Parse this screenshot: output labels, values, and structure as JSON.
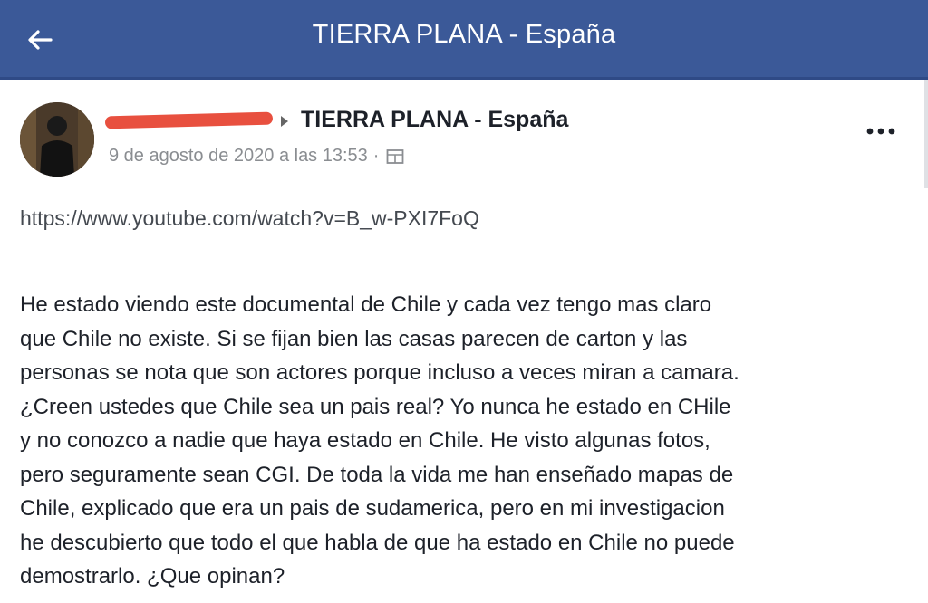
{
  "header": {
    "title": "TIERRA PLANA - España",
    "back_icon": "arrow-left-icon"
  },
  "post": {
    "group_name": "TIERRA PLANA - España",
    "timestamp": "9 de agosto de 2020 a las 13:53",
    "separator": "·",
    "privacy_icon": "members-icon",
    "more_icon": "ellipsis-icon",
    "link": "https://www.youtube.com/watch?v=B_w-PXI7FoQ",
    "body_lines": [
      "He estado viendo este documental de Chile y cada vez tengo mas claro",
      "que Chile no existe. Si se fijan bien las casas parecen de carton y las",
      "personas se nota que son actores porque incluso a veces miran a camara.",
      "¿Creen ustedes que Chile sea un pais real? Yo nunca he estado en CHile",
      "y no conozco a nadie que haya estado en Chile. He visto algunas fotos,",
      "pero seguramente sean CGI. De toda la vida me han enseñado mapas de",
      "Chile, explicado que era un pais de sudamerica, pero en mi investigacion",
      "he descubierto que todo el que habla de que ha estado en Chile no puede",
      "demostrarlo. ¿Que opinan?"
    ]
  },
  "colors": {
    "header_bg": "#3b5998",
    "text": "#1d2129",
    "meta_text": "#8a8d91",
    "redaction": "#e8503f"
  }
}
